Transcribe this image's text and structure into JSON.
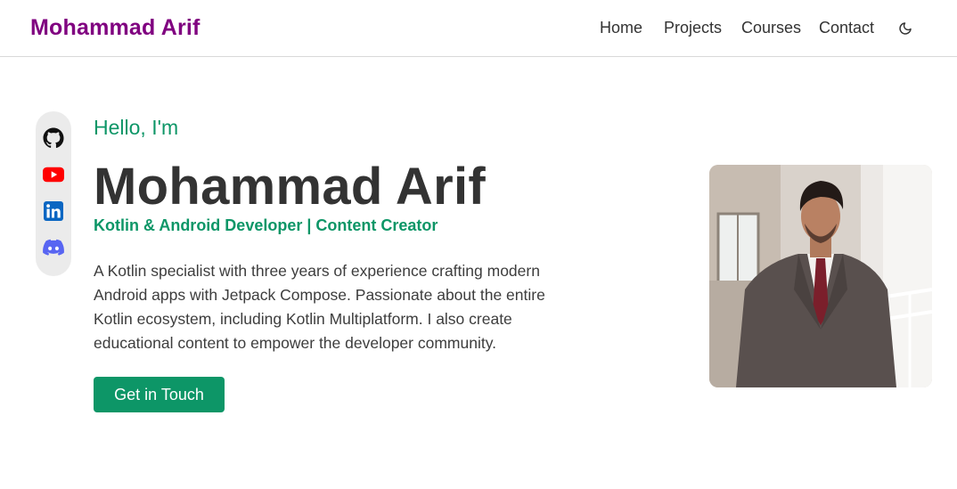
{
  "navbar": {
    "brand": "Mohammad Arif",
    "links": [
      {
        "label": "Home"
      },
      {
        "label": "Projects"
      },
      {
        "label": "Courses"
      },
      {
        "label": "Contact"
      }
    ],
    "theme_toggle_icon": "moon-icon"
  },
  "social": [
    {
      "icon": "github-icon"
    },
    {
      "icon": "youtube-icon"
    },
    {
      "icon": "linkedin-icon"
    },
    {
      "icon": "discord-icon"
    }
  ],
  "hero": {
    "greeting": "Hello, I'm",
    "name": "Mohammad Arif",
    "tagline": "Kotlin & Android Developer | Content Creator",
    "bio": "A Kotlin specialist with three years of experience crafting modern Android apps with Jetpack Compose. Passionate about the entire Kotlin ecosystem, including Kotlin Multiplatform. I also create educational content to empower the developer community.",
    "cta_label": "Get in Touch",
    "photo_icon": "profile-photo"
  },
  "colors": {
    "brand": "#800080",
    "accent": "#0d9667",
    "text": "#333333",
    "youtube": "#ff0000",
    "linkedin": "#0a66c2",
    "discord": "#5865f2"
  }
}
